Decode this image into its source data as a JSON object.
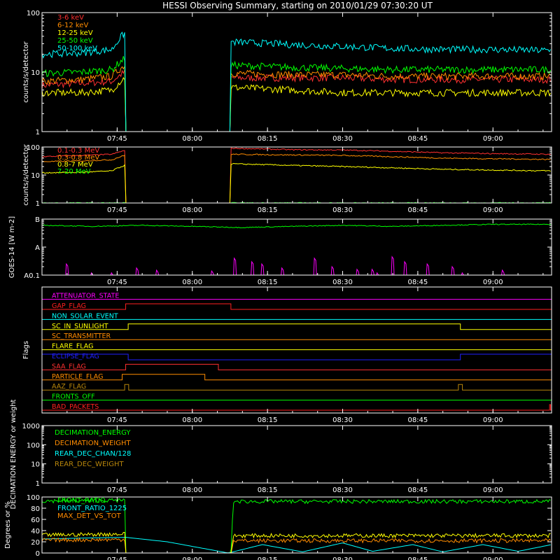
{
  "title": "HESSI Observing Summary, starting on 2010/01/29 07:30:20 UT",
  "time_labels": [
    "07:45",
    "08:00",
    "08:15",
    "08:30",
    "08:45",
    "09:00"
  ],
  "time_ticks_min": [
    15,
    30,
    45,
    60,
    75,
    90
  ],
  "time_range_min": [
    0,
    101.7
  ],
  "chart_data": [
    {
      "id": "lightcurve-low",
      "type": "line",
      "ylabel": "counts/s/detector",
      "yscale": "log",
      "ylim": [
        1,
        100
      ],
      "ytick_labels": [
        "1",
        "10",
        "100"
      ],
      "ytick_values": [
        1,
        10,
        100
      ],
      "legend_position": "top-left",
      "data_gap_min": [
        16.7,
        37.7
      ],
      "series": [
        {
          "name": "3-6 keV",
          "color": "#ff3030",
          "x": [
            0,
            8,
            14,
            16.5,
            38.2,
            50,
            60,
            70,
            80,
            90,
            101.7
          ],
          "y": [
            6,
            6.5,
            7,
            10,
            8,
            8,
            8,
            7.5,
            7.5,
            7.5,
            7.5
          ]
        },
        {
          "name": "6-12 keV",
          "color": "#ff8c00",
          "x": [
            0,
            8,
            14,
            16.5,
            38.2,
            50,
            60,
            70,
            80,
            90,
            101.7
          ],
          "y": [
            7,
            7.5,
            8.5,
            13,
            9.5,
            9,
            9,
            8.5,
            8.5,
            8.5,
            8.5
          ]
        },
        {
          "name": "12-25 keV",
          "color": "#ffff00",
          "x": [
            0,
            8,
            14,
            16.5,
            38.2,
            50,
            60,
            70,
            80,
            90,
            101.7
          ],
          "y": [
            4.5,
            4.5,
            5,
            8,
            5.5,
            5,
            4.5,
            4.5,
            4.5,
            4.5,
            4.5
          ]
        },
        {
          "name": "25-50 keV",
          "color": "#00ff00",
          "x": [
            0,
            8,
            14,
            16.5,
            38.2,
            50,
            60,
            70,
            80,
            90,
            101.7
          ],
          "y": [
            9.5,
            10,
            11,
            17,
            13,
            12,
            11.5,
            11,
            11,
            11,
            11
          ]
        },
        {
          "name": "50-100 keV",
          "color": "#00ffff",
          "x": [
            0,
            8,
            14,
            16.5,
            38.2,
            50,
            60,
            70,
            80,
            90,
            101.7
          ],
          "y": [
            20,
            21,
            24,
            45,
            32,
            29,
            27,
            25,
            24,
            24,
            23
          ]
        }
      ]
    },
    {
      "id": "lightcurve-high",
      "type": "line",
      "ylabel": "counts/s/detector",
      "yscale": "log",
      "ylim": [
        1,
        100
      ],
      "ytick_labels": [
        "1",
        "10",
        "100"
      ],
      "ytick_values": [
        1,
        10,
        100
      ],
      "legend_position": "top-left",
      "data_gap_min": [
        16.7,
        37.7
      ],
      "series": [
        {
          "name": "0.1-0.3 MeV",
          "color": "#ff3030",
          "x": [
            0,
            8,
            14,
            16.5,
            38.2,
            50,
            60,
            70,
            80,
            90,
            101.7
          ],
          "y": [
            45,
            50,
            55,
            75,
            90,
            80,
            78,
            70,
            62,
            58,
            55
          ]
        },
        {
          "name": "0.3-0.8 MeV",
          "color": "#ff8c00",
          "x": [
            0,
            8,
            14,
            16.5,
            38.2,
            50,
            60,
            70,
            80,
            90,
            101.7
          ],
          "y": [
            30,
            32,
            35,
            50,
            55,
            52,
            50,
            45,
            40,
            38,
            36
          ]
        },
        {
          "name": "0.8-7 MeV",
          "color": "#ffff00",
          "x": [
            0,
            8,
            14,
            16.5,
            38.2,
            50,
            60,
            70,
            80,
            90,
            101.7
          ],
          "y": [
            12,
            12.5,
            14,
            22,
            25,
            22,
            20,
            18,
            16,
            15,
            14
          ]
        },
        {
          "name": "7-20 MeV",
          "color": "#00ff00",
          "x": [
            0,
            101.7
          ],
          "y": [
            1,
            1
          ]
        }
      ]
    },
    {
      "id": "goes",
      "type": "line",
      "ylabel": "GOES-14 [W m-2]",
      "yscale": "log",
      "ylim": [
        1e-08,
        1e-06
      ],
      "ytick_labels": [
        "A0.1",
        "A",
        "B"
      ],
      "ytick_values": [
        1e-08,
        1e-07,
        1e-06
      ],
      "series": [
        {
          "name": "GOES long",
          "color": "#00ff00",
          "x": [
            0,
            10,
            20,
            30,
            40,
            50,
            60,
            70,
            80,
            90,
            101.7
          ],
          "y": [
            6e-07,
            5.5e-07,
            6e-07,
            5.5e-07,
            5e-07,
            5.5e-07,
            6e-07,
            5.5e-07,
            6e-07,
            6.5e-07,
            6.5e-07
          ]
        }
      ],
      "spikes": [
        {
          "name": "GOES short",
          "color": "#ff00ff",
          "x": [
            5,
            10,
            14,
            19,
            23,
            34,
            38.5,
            42,
            44,
            48,
            54.5,
            58,
            63,
            66,
            67,
            70,
            72.5,
            77,
            82,
            84,
            92
          ],
          "y": [
            2.5e-08,
            1.2e-08,
            1.2e-08,
            1.8e-08,
            1.5e-08,
            1.4e-08,
            4e-08,
            3e-08,
            2.5e-08,
            1.8e-08,
            4e-08,
            2e-08,
            1.6e-08,
            1.6e-08,
            1.2e-08,
            4.5e-08,
            3e-08,
            2.5e-08,
            2e-08,
            1.2e-08,
            1.5e-08
          ]
        }
      ]
    },
    {
      "id": "flags",
      "type": "line",
      "ylabel": "Flags",
      "flags": [
        {
          "name": "ATTENUATOR_STATE",
          "color": "#ff00ff",
          "steps": [
            [
              0,
              0
            ],
            [
              101.7,
              0
            ]
          ]
        },
        {
          "name": "GAP_FLAG",
          "color": "#ff2020",
          "steps": [
            [
              0,
              0
            ],
            [
              16.7,
              1
            ],
            [
              37.7,
              0
            ],
            [
              101.7,
              0
            ]
          ]
        },
        {
          "name": "NON_SOLAR_EVENT",
          "color": "#00ffff",
          "steps": [
            [
              0,
              0
            ],
            [
              101.7,
              0
            ]
          ]
        },
        {
          "name": "SC_IN_SUNLIGHT",
          "color": "#ffff00",
          "steps": [
            [
              0,
              0
            ],
            [
              17.2,
              1
            ],
            [
              83.5,
              0
            ],
            [
              101.7,
              0
            ]
          ]
        },
        {
          "name": "SC_TRANSMITTER",
          "color": "#ff8c00",
          "steps": [
            [
              0,
              0
            ],
            [
              101.7,
              0
            ]
          ]
        },
        {
          "name": "FLARE_FLAG",
          "color": "#ffff00",
          "steps": [
            [
              0,
              0
            ],
            [
              101.7,
              0
            ]
          ]
        },
        {
          "name": "ECLIPSE_FLAG",
          "color": "#2020ff",
          "steps": [
            [
              0,
              1
            ],
            [
              17.2,
              0
            ],
            [
              83.5,
              1
            ],
            [
              101.7,
              1
            ]
          ]
        },
        {
          "name": "SAA_FLAG",
          "color": "#ff3030",
          "steps": [
            [
              0,
              0
            ],
            [
              16.7,
              1
            ],
            [
              35.2,
              0
            ],
            [
              101.7,
              0
            ]
          ]
        },
        {
          "name": "PARTICLE_FLAG",
          "color": "#ff8c00",
          "steps": [
            [
              0,
              0
            ],
            [
              16.0,
              1
            ],
            [
              32.5,
              0
            ],
            [
              101.7,
              0
            ]
          ]
        },
        {
          "name": "AAZ_FLAG",
          "color": "#b8860b",
          "steps": [
            [
              0,
              0
            ],
            [
              16.5,
              1
            ],
            [
              17.3,
              0
            ],
            [
              83.1,
              1
            ],
            [
              83.9,
              0
            ],
            [
              101.7,
              0
            ]
          ]
        },
        {
          "name": "FRONTS_OFF",
          "color": "#00ff00",
          "steps": [
            [
              0,
              0
            ],
            [
              101.7,
              0
            ]
          ]
        },
        {
          "name": "BAD_PACKETS",
          "color": "#ff2020",
          "steps": [
            [
              0,
              0
            ],
            [
              101.3,
              1
            ],
            [
              101.5,
              0
            ],
            [
              101.7,
              0
            ]
          ]
        }
      ]
    },
    {
      "id": "decimation",
      "type": "line",
      "ylabel": "DECIMATION ENERGY or weight",
      "yscale": "log",
      "ylim": [
        1,
        1000
      ],
      "ytick_labels": [
        "1",
        "10",
        "100",
        "1000"
      ],
      "ytick_values": [
        1,
        10,
        100,
        1000
      ],
      "legend_position": "top-left",
      "series": [
        {
          "name": "DECIMATION_ENERGY",
          "color": "#00ff00",
          "x": [
            0,
            101.7
          ],
          "y": [
            1,
            1
          ]
        },
        {
          "name": "DECIMATION_WEIGHT",
          "color": "#ff8c00",
          "x": [
            0,
            101.7
          ],
          "y": [
            1,
            1
          ]
        },
        {
          "name": "REAR_DEC_CHAN/128",
          "color": "#00ffff",
          "x": [
            0,
            101.7
          ],
          "y": [
            1,
            1
          ]
        },
        {
          "name": "REAR_DEC_WEIGHT",
          "color": "#b8860b",
          "x": [
            0,
            101.7
          ],
          "y": [
            1,
            1
          ]
        }
      ]
    },
    {
      "id": "ratios",
      "type": "line",
      "ylabel": "Degrees or %",
      "yscale": "linear",
      "ylim": [
        0,
        100
      ],
      "ytick_labels": [
        "0",
        "20",
        "40",
        "60",
        "80",
        "100"
      ],
      "ytick_values": [
        0,
        20,
        40,
        60,
        80,
        100
      ],
      "legend_position": "top-left",
      "series": [
        {
          "name": "FRONT_RATIO",
          "color": "#00ff00",
          "x": [
            0,
            16.5,
            16.7,
            37.7,
            38.2,
            101.7
          ],
          "y": [
            93,
            94,
            0,
            0,
            92,
            92
          ]
        },
        {
          "name": "FRONT_RATIO_1225",
          "color": "#00ffff",
          "x": [
            0,
            10,
            16.7,
            25,
            37.2,
            44,
            52,
            60,
            66,
            74,
            80,
            88,
            95,
            101.7
          ],
          "y": [
            25,
            27,
            28,
            20,
            0,
            15,
            2,
            18,
            3,
            15,
            2,
            15,
            3,
            15
          ]
        },
        {
          "name": "MAX_DET_VS_TOT",
          "color": "#ff8c00",
          "x": [
            0,
            16.5,
            16.7,
            37.7,
            38.2,
            101.7
          ],
          "y": [
            23,
            24,
            0,
            0,
            22,
            22
          ]
        },
        {
          "name": "",
          "color": "#ffff00",
          "x": [
            0,
            16.5,
            16.7,
            37.7,
            38.2,
            101.7
          ],
          "y": [
            32,
            34,
            0,
            0,
            31,
            31
          ]
        }
      ]
    }
  ]
}
